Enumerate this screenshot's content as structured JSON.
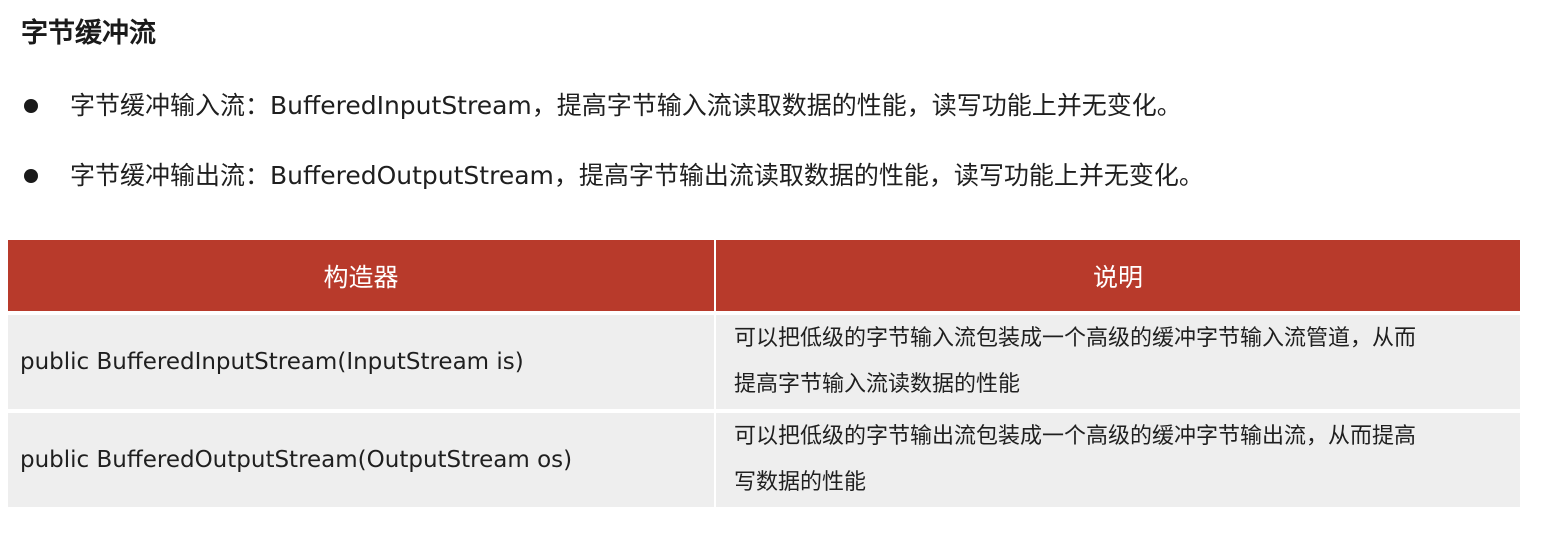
{
  "heading": "字节缓冲流",
  "bullets": [
    {
      "text": "字节缓冲输入流：BufferedInputStream，提高字节输入流读取数据的性能，读写功能上并无变化。"
    },
    {
      "text": "字节缓冲输出流：BufferedOutputStream，提高字节输出流读取数据的性能，读写功能上并无变化。"
    }
  ],
  "table": {
    "headers": [
      "构造器",
      "说明"
    ],
    "rows": [
      {
        "constructor": "public BufferedInputStream(InputStream is)",
        "description_line1": "可以把低级的字节输入流包装成一个高级的缓冲字节输入流管道，从而",
        "description_line2": "提高字节输入流读数据的性能"
      },
      {
        "constructor": "public BufferedOutputStream(OutputStream os)",
        "description_line1": "可以把低级的字节输出流包装成一个高级的缓冲字节输出流，从而提高",
        "description_line2": "写数据的性能"
      }
    ]
  },
  "colors": {
    "header_background": "#b83a2b",
    "row_background": "#eeeeee"
  }
}
